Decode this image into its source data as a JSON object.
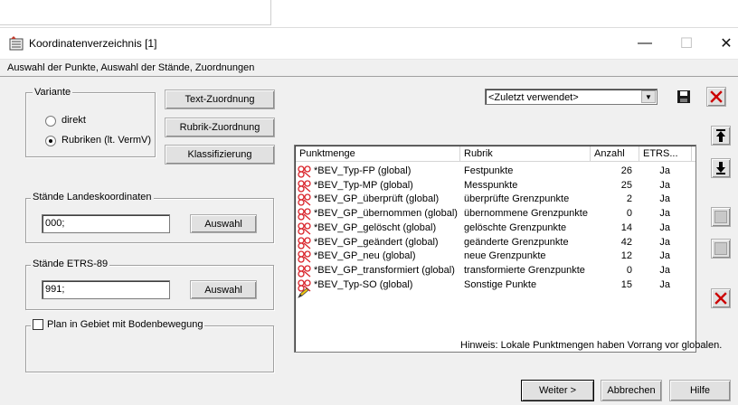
{
  "window": {
    "title": "Koordinatenverzeichnis [1]",
    "minimize_glyph": "—",
    "maximize_glyph": "☐",
    "close_glyph": "✕",
    "subtitle": "Auswahl der Punkte, Auswahl der Stände, Zuordnungen"
  },
  "variante": {
    "label": "Variante",
    "options": [
      {
        "label": "direkt",
        "selected": false
      },
      {
        "label": "Rubriken (lt. VermV)",
        "selected": true
      }
    ]
  },
  "buttons": {
    "text_zuordnung": "Text-Zuordnung",
    "rubrik_zuordnung": "Rubrik-Zuordnung",
    "klassifizierung": "Klassifizierung",
    "weiter": "Weiter >",
    "abbrechen": "Abbrechen",
    "hilfe": "Hilfe"
  },
  "staende_landes": {
    "label": "Stände Landeskoordinaten",
    "value": "000;",
    "button": "Auswahl"
  },
  "staende_etrs": {
    "label": "Stände ETRS-89",
    "value": "991;",
    "button": "Auswahl"
  },
  "plan_checkbox": {
    "label": "Plan in Gebiet mit Bodenbewegung",
    "checked": false
  },
  "preset": {
    "selected": "<Zuletzt verwendet>"
  },
  "table": {
    "columns": [
      "Punktmenge",
      "Rubrik",
      "Anzahl",
      "ETRS..."
    ],
    "rows": [
      {
        "punktmenge": "*BEV_Typ-FP (global)",
        "rubrik": "Festpunkte",
        "anzahl": "26",
        "etrs": "Ja"
      },
      {
        "punktmenge": "*BEV_Typ-MP (global)",
        "rubrik": "Messpunkte",
        "anzahl": "25",
        "etrs": "Ja"
      },
      {
        "punktmenge": "*BEV_GP_überprüft (global)",
        "rubrik": "überprüfte Grenzpunkte",
        "anzahl": "2",
        "etrs": "Ja"
      },
      {
        "punktmenge": "*BEV_GP_übernommen (global)",
        "rubrik": "übernommene Grenzpunkte",
        "anzahl": "0",
        "etrs": "Ja"
      },
      {
        "punktmenge": "*BEV_GP_gelöscht (global)",
        "rubrik": "gelöschte Grenzpunkte",
        "anzahl": "14",
        "etrs": "Ja"
      },
      {
        "punktmenge": "*BEV_GP_geändert (global)",
        "rubrik": "geänderte Grenzpunkte",
        "anzahl": "42",
        "etrs": "Ja"
      },
      {
        "punktmenge": "*BEV_GP_neu (global)",
        "rubrik": "neue Grenzpunkte",
        "anzahl": "12",
        "etrs": "Ja"
      },
      {
        "punktmenge": "*BEV_GP_transformiert (global)",
        "rubrik": "transformierte Grenzpunkte",
        "anzahl": "0",
        "etrs": "Ja"
      },
      {
        "punktmenge": "*BEV_Typ-SO (global)",
        "rubrik": "Sonstige Punkte",
        "anzahl": "15",
        "etrs": "Ja"
      }
    ]
  },
  "hint": "Hinweis: Lokale Punktmengen haben Vorrang vor globalen.",
  "colors": {
    "symbol_red": "#d9232a",
    "delete_red": "#cc0000",
    "dialog_bg": "#f0f0f0"
  }
}
